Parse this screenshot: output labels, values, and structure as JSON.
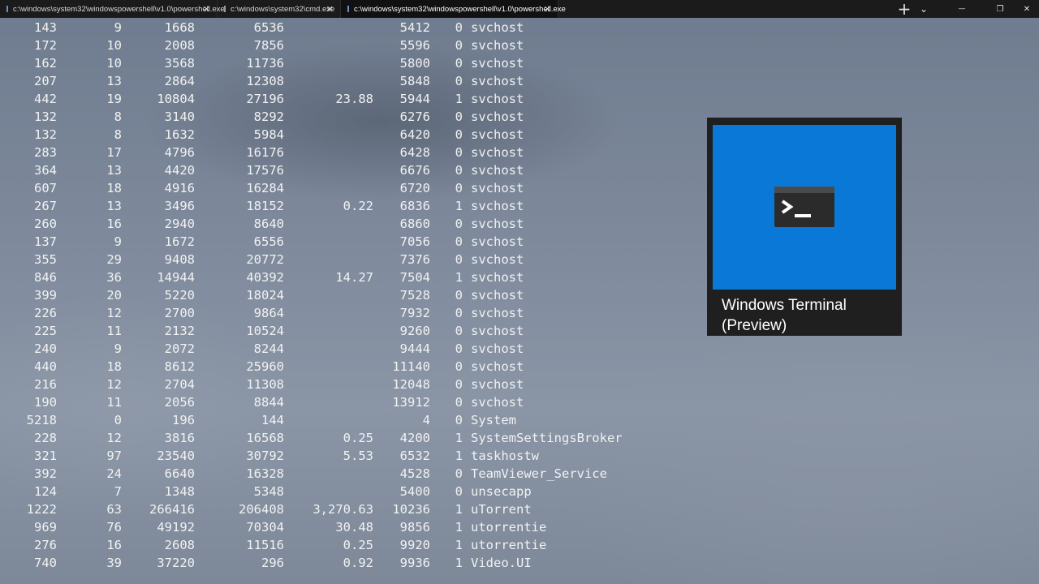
{
  "tabs": [
    {
      "label": "c:\\windows\\system32\\windowspowershell\\v1.0\\powershell.exe",
      "icon": "powershell-icon",
      "active": false
    },
    {
      "label": "c:\\windows\\system32\\cmd.exe",
      "icon": "cmd-icon",
      "active": false
    },
    {
      "label": "c:\\windows\\system32\\windowspowershell\\v1.0\\powershell.exe",
      "icon": "powershell-icon",
      "active": true
    }
  ],
  "titlebar": {
    "new_tab": "+",
    "dropdown": "⌄",
    "minimize": "—",
    "maximize": "❐",
    "close": "✕",
    "tab_close": "✕"
  },
  "rows": [
    [
      "143",
      "9",
      "1668",
      "6536",
      "",
      "5412",
      "0",
      "svchost"
    ],
    [
      "172",
      "10",
      "2008",
      "7856",
      "",
      "5596",
      "0",
      "svchost"
    ],
    [
      "162",
      "10",
      "3568",
      "11736",
      "",
      "5800",
      "0",
      "svchost"
    ],
    [
      "207",
      "13",
      "2864",
      "12308",
      "",
      "5848",
      "0",
      "svchost"
    ],
    [
      "442",
      "19",
      "10804",
      "27196",
      "23.88",
      "5944",
      "1",
      "svchost"
    ],
    [
      "132",
      "8",
      "3140",
      "8292",
      "",
      "6276",
      "0",
      "svchost"
    ],
    [
      "132",
      "8",
      "1632",
      "5984",
      "",
      "6420",
      "0",
      "svchost"
    ],
    [
      "283",
      "17",
      "4796",
      "16176",
      "",
      "6428",
      "0",
      "svchost"
    ],
    [
      "364",
      "13",
      "4420",
      "17576",
      "",
      "6676",
      "0",
      "svchost"
    ],
    [
      "607",
      "18",
      "4916",
      "16284",
      "",
      "6720",
      "0",
      "svchost"
    ],
    [
      "267",
      "13",
      "3496",
      "18152",
      "0.22",
      "6836",
      "1",
      "svchost"
    ],
    [
      "260",
      "16",
      "2940",
      "8640",
      "",
      "6860",
      "0",
      "svchost"
    ],
    [
      "137",
      "9",
      "1672",
      "6556",
      "",
      "7056",
      "0",
      "svchost"
    ],
    [
      "355",
      "29",
      "9408",
      "20772",
      "",
      "7376",
      "0",
      "svchost"
    ],
    [
      "846",
      "36",
      "14944",
      "40392",
      "14.27",
      "7504",
      "1",
      "svchost"
    ],
    [
      "399",
      "20",
      "5220",
      "18024",
      "",
      "7528",
      "0",
      "svchost"
    ],
    [
      "226",
      "12",
      "2700",
      "9864",
      "",
      "7932",
      "0",
      "svchost"
    ],
    [
      "225",
      "11",
      "2132",
      "10524",
      "",
      "9260",
      "0",
      "svchost"
    ],
    [
      "240",
      "9",
      "2072",
      "8244",
      "",
      "9444",
      "0",
      "svchost"
    ],
    [
      "440",
      "18",
      "8612",
      "25960",
      "",
      "11140",
      "0",
      "svchost"
    ],
    [
      "216",
      "12",
      "2704",
      "11308",
      "",
      "12048",
      "0",
      "svchost"
    ],
    [
      "190",
      "11",
      "2056",
      "8844",
      "",
      "13912",
      "0",
      "svchost"
    ],
    [
      "5218",
      "0",
      "196",
      "144",
      "",
      "4",
      "0",
      "System"
    ],
    [
      "228",
      "12",
      "3816",
      "16568",
      "0.25",
      "4200",
      "1",
      "SystemSettingsBroker"
    ],
    [
      "321",
      "97",
      "23540",
      "30792",
      "5.53",
      "6532",
      "1",
      "taskhostw"
    ],
    [
      "392",
      "24",
      "6640",
      "16328",
      "",
      "4528",
      "0",
      "TeamViewer_Service"
    ],
    [
      "124",
      "7",
      "1348",
      "5348",
      "",
      "5400",
      "0",
      "unsecapp"
    ],
    [
      "1222",
      "63",
      "266416",
      "206408",
      "3,270.63",
      "10236",
      "1",
      "uTorrent"
    ],
    [
      "969",
      "76",
      "49192",
      "70304",
      "30.48",
      "9856",
      "1",
      "utorrentie"
    ],
    [
      "276",
      "16",
      "2608",
      "11516",
      "0.25",
      "9920",
      "1",
      "utorrentie"
    ],
    [
      "740",
      "39",
      "37220",
      "296",
      "0.92",
      "9936",
      "1",
      "Video.UI"
    ]
  ],
  "tile": {
    "label_line1": "Windows Terminal",
    "label_line2": "(Preview)",
    "icon": "terminal-prompt-icon",
    "color": "#0a78d7"
  }
}
